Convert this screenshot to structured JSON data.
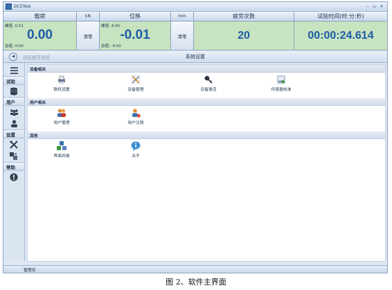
{
  "window": {
    "title": "DCSTest",
    "controls": [
      "–",
      "▭",
      "✕"
    ]
  },
  "meters": {
    "load": {
      "header": "载荷",
      "unit": "kN",
      "peak": "峰值: 0.01",
      "value": "0.00",
      "valley": "谷值: 0.00",
      "zero_label": "清零"
    },
    "displacement": {
      "header": "位移",
      "unit": "mm",
      "peak": "峰值: 4.00",
      "value": "-0.01",
      "valley": "谷值: -4.00",
      "zero_label": "清零"
    },
    "cycles": {
      "header": "疲劳次数",
      "value": "20"
    },
    "time": {
      "header": "试验时间(时:分:秒)",
      "value": "00:00:24.614"
    }
  },
  "nav": {
    "back_icon": "circle-arrow-left-icon",
    "breadcrumb": "动态疲劳试验",
    "title": "系统设置"
  },
  "sidebar": {
    "sections": [
      {
        "label": "试验",
        "icons": [
          "database-icon"
        ]
      },
      {
        "label": "用户",
        "icons": [
          "user-group-icon",
          "user-icon"
        ]
      },
      {
        "label": "设置",
        "icons": [
          "tools-icon",
          "blocks-icon"
        ]
      },
      {
        "label": "帮助",
        "icons": [
          "info-icon"
        ]
      }
    ],
    "top_icon": "list-icon"
  },
  "content": {
    "sections": [
      {
        "title": "设备相关",
        "items": [
          {
            "label": "联机设置",
            "icon": "printer-icon"
          },
          {
            "label": "设备管理",
            "icon": "tools-icon"
          },
          {
            "label": "设备激活",
            "icon": "key-icon"
          },
          {
            "label": "传感器校准",
            "icon": "calibration-icon"
          }
        ]
      },
      {
        "title": "用户相关",
        "items": [
          {
            "label": "用户管理",
            "icon": "users-icon"
          },
          {
            "label": "用户注销",
            "icon": "user-logout-icon"
          }
        ]
      },
      {
        "title": "其他",
        "items": [
          {
            "label": "界面风格",
            "icon": "style-blocks-icon"
          },
          {
            "label": "关于",
            "icon": "about-icon"
          }
        ]
      }
    ]
  },
  "statusbar": {
    "user": "管理员"
  },
  "caption": "图 2、软件主界面",
  "colors": {
    "meter_bg": "#c7e3bf",
    "value_text": "#1d5ba8",
    "frame": "#8aa2c2",
    "panel": "#dfe8f4"
  }
}
